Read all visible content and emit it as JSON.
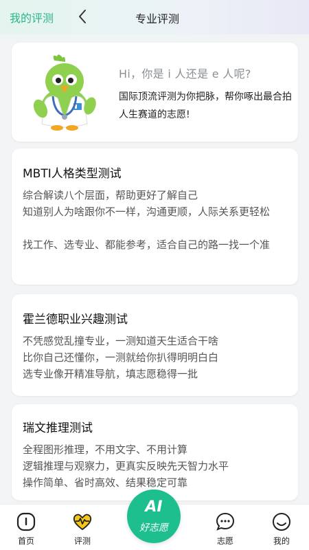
{
  "header": {
    "left_label": "我的评测",
    "title": "专业评测"
  },
  "intro": {
    "question": "Hi，你是 i 人还是 e 人呢?",
    "description": "国际顶流评测为你把脉，帮你啄出最合拍人生赛道的志愿!"
  },
  "tests": [
    {
      "title": "MBTI人格类型测试",
      "lines": [
        "综合解读八个层面，帮助更好了解自己",
        "知道别人为啥跟你不一样，沟通更顺，人际关系更轻松",
        "找工作、选专业、都能参考，适合自己的路一找一个准"
      ]
    },
    {
      "title": "霍兰德职业兴趣测试",
      "lines": [
        "不凭感觉乱撞专业，一测知道天生适合干啥",
        "比你自己还懂你，一测就给你扒得明明白白",
        "选专业像开精准导航，填志愿稳得一批"
      ]
    },
    {
      "title": "瑞文推理测试",
      "lines": [
        "全程图形推理，不用文字、不用计算",
        "逻辑推理与观察力，更真实反映先天智力水平",
        "操作简单、省时高效、结果稳定可靠"
      ]
    }
  ],
  "tabbar": {
    "items": [
      {
        "label": "首页",
        "icon": "home-icon"
      },
      {
        "label": "评测",
        "icon": "heartbeat-icon",
        "active": true
      },
      {
        "label": "志愿",
        "icon": "chat-icon"
      },
      {
        "label": "我的",
        "icon": "smile-icon"
      }
    ],
    "center": {
      "title": "AI",
      "subtitle": "好志愿"
    }
  },
  "colors": {
    "accent": "#1dbf8e",
    "active_icon": "#f5c518"
  }
}
